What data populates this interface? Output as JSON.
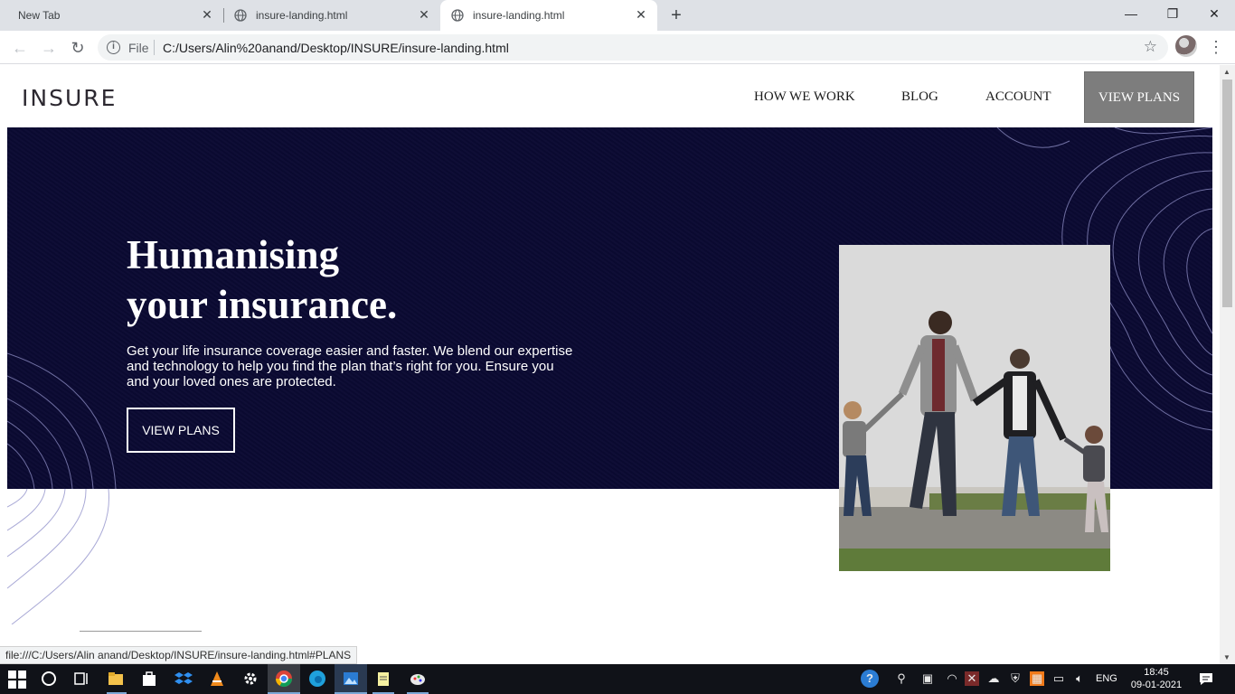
{
  "browser": {
    "tabs": [
      {
        "title": "New Tab",
        "active": false
      },
      {
        "title": "insure-landing.html",
        "active": false
      },
      {
        "title": "insure-landing.html",
        "active": true
      }
    ],
    "address": {
      "scheme_label": "File",
      "url": "C:/Users/Alin%20anand/Desktop/INSURE/insure-landing.html"
    },
    "status_url": "file:///C:/Users/Alin anand/Desktop/INSURE/insure-landing.html#PLANS"
  },
  "page": {
    "logo": "INSURE",
    "nav": {
      "links": [
        "HOW WE WORK",
        "BLOG",
        "ACCOUNT"
      ],
      "cta": "VIEW PLANS"
    },
    "hero": {
      "title_line1": "Humanising",
      "title_line2": "your insurance.",
      "text": "Get your life insurance coverage easier and faster. We blend our expertise and technology to help you find the plan that’s right for you. Ensure you and your loved ones are protected.",
      "cta": "VIEW PLANS",
      "background_color": "#0b0a33",
      "photo_subject": "family-walking-photo"
    }
  },
  "taskbar": {
    "language": "ENG",
    "time": "18:45",
    "date": "09-01-2021"
  }
}
